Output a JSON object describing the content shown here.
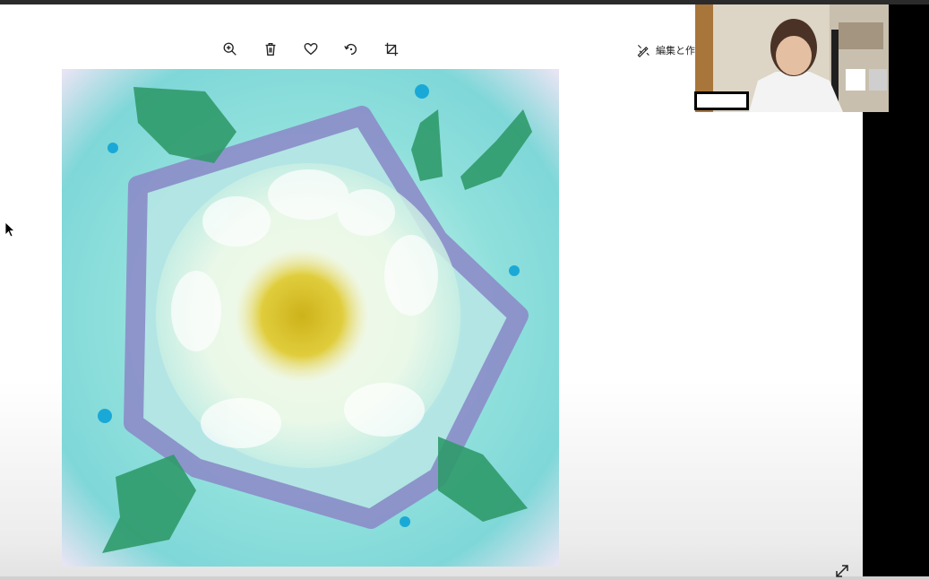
{
  "toolbar": {
    "zoom_in": "zoom-in-icon",
    "delete": "trash-icon",
    "favorite": "heart-icon",
    "rotate": "rotate-icon",
    "crop": "crop-icon"
  },
  "edit_create": {
    "label": "編集と作成",
    "icon": "edit-create-icon"
  },
  "colors": {
    "topbar": "#2b2b2b",
    "viewer_bg": "#ffffff",
    "side_bg": "#000000",
    "artwork_teal": "#7fd7d8",
    "artwork_violet": "#8c88c8",
    "artwork_leaf": "#2f9a6a",
    "artwork_center": "#d7c21f"
  }
}
